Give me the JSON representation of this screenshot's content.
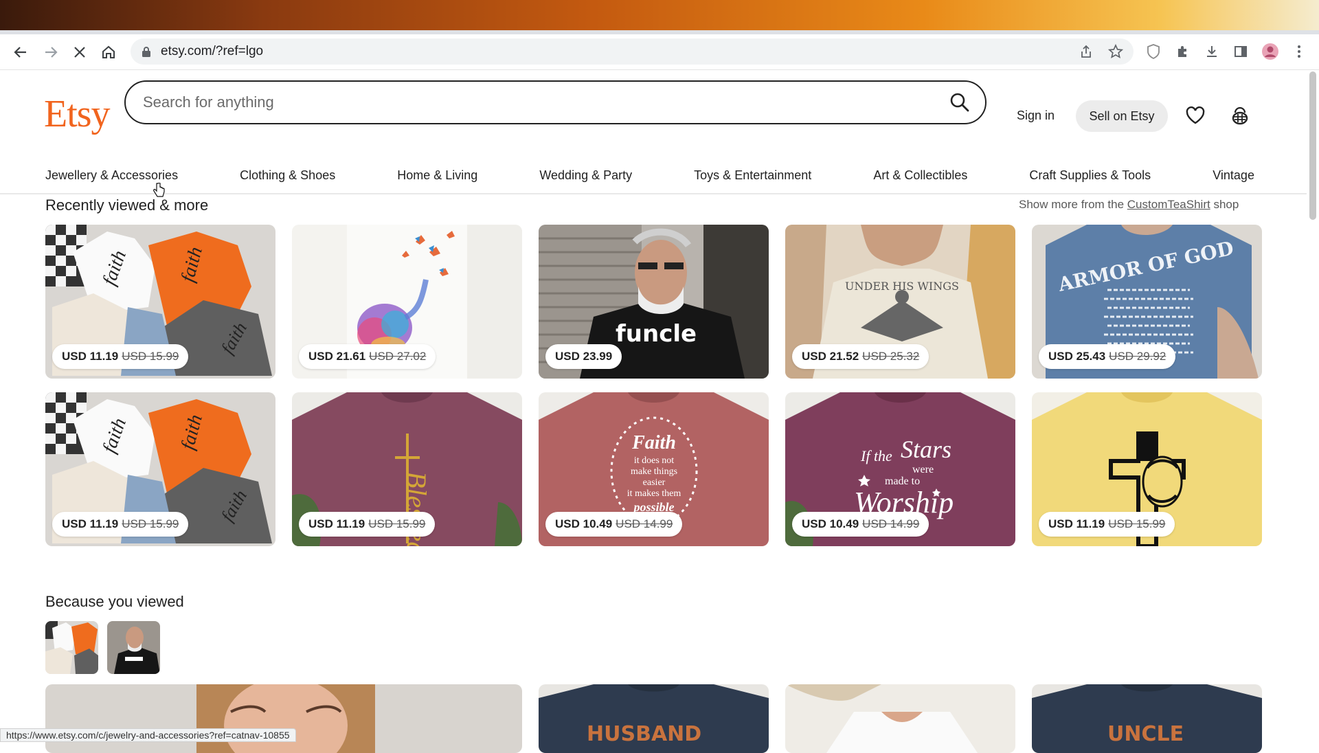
{
  "browser": {
    "url": "etsy.com/?ref=lgo",
    "status_url": "https://www.etsy.com/c/jewelry-and-accessories?ref=catnav-10855"
  },
  "header": {
    "logo": "Etsy",
    "search_placeholder": "Search for anything",
    "sign_in": "Sign in",
    "sell": "Sell on Etsy"
  },
  "categories": [
    "Jewellery & Accessories",
    "Clothing & Shoes",
    "Home & Living",
    "Wedding & Party",
    "Toys & Entertainment",
    "Art & Collectibles",
    "Craft Supplies & Tools",
    "Vintage"
  ],
  "recently_viewed": {
    "title": "Recently viewed & more",
    "show_more_prefix": "Show more from the ",
    "shop_name": "CustomTeaShirt",
    "show_more_suffix": " shop",
    "items": [
      {
        "price": "USD 11.19",
        "was": "USD 15.99"
      },
      {
        "price": "USD 21.61",
        "was": "USD 27.02"
      },
      {
        "price": "USD 23.99",
        "was": ""
      },
      {
        "price": "USD 21.52",
        "was": "USD 25.32"
      },
      {
        "price": "USD 25.43",
        "was": "USD 29.92"
      },
      {
        "price": "USD 11.19",
        "was": "USD 15.99"
      },
      {
        "price": "USD 11.19",
        "was": "USD 15.99"
      },
      {
        "price": "USD 10.49",
        "was": "USD 14.99"
      },
      {
        "price": "USD 10.49",
        "was": "USD 14.99"
      },
      {
        "price": "USD 11.19",
        "was": "USD 15.99"
      }
    ]
  },
  "because_viewed": {
    "title": "Because you viewed"
  },
  "product_art": {
    "funcle": "funcle",
    "under_his_wings": "UNDER HIS WINGS",
    "armor_of_god": "ARMOR OF GOD",
    "faith": "faith",
    "blessed": "Blessed",
    "faith_quote": [
      "Faith",
      "it does not",
      "make things",
      "easier",
      "it makes them",
      "possible"
    ],
    "stars_quote": [
      "If the",
      "Stars",
      "were",
      "made to",
      "Worship"
    ],
    "husband": "HUSBAND",
    "uncle": "UNCLE"
  },
  "colors": {
    "etsy_orange": "#f1641e",
    "text": "#222222"
  }
}
